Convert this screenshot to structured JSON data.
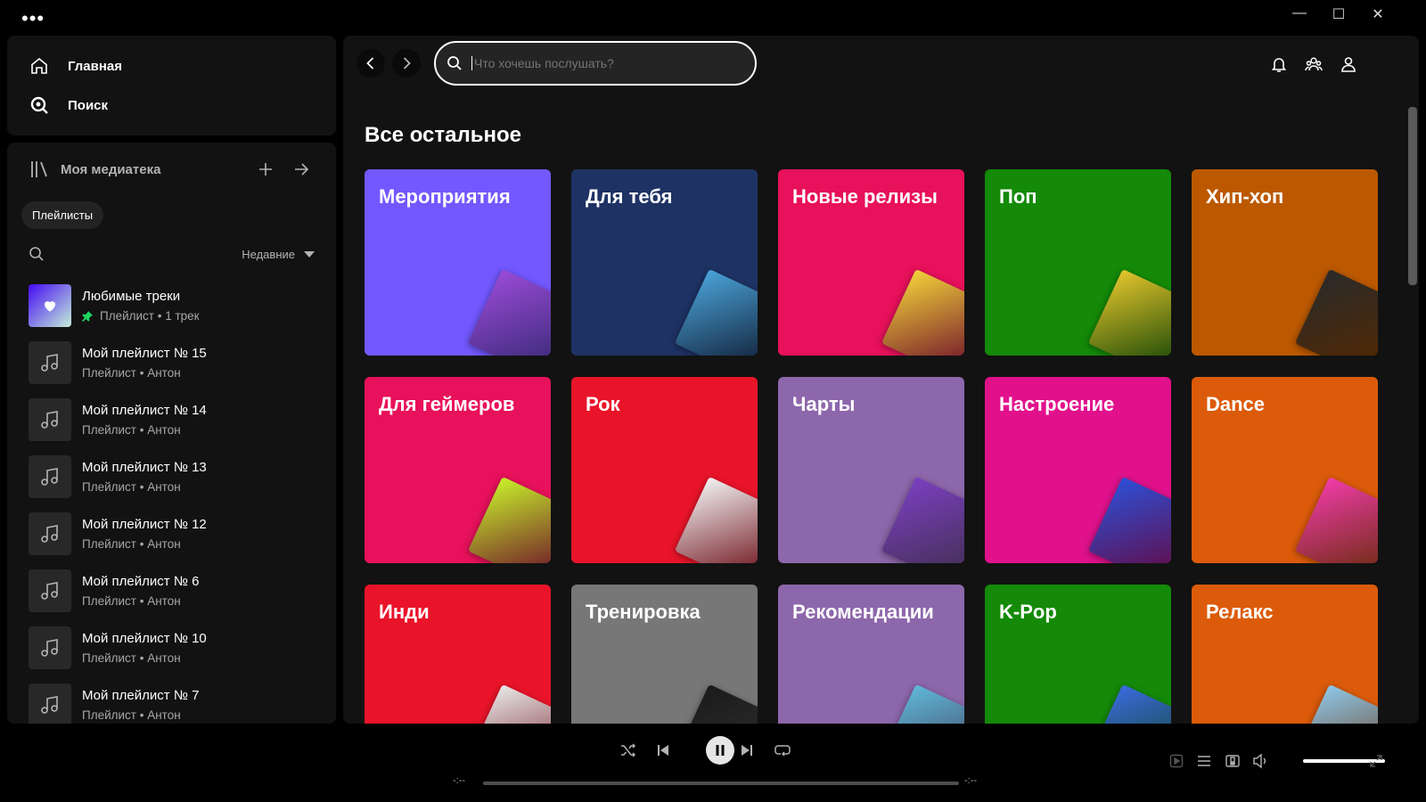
{
  "window": {
    "menu_dots": "•••",
    "minimize": "—",
    "maximize": "☐",
    "close": "✕"
  },
  "nav": {
    "home_label": "Главная",
    "search_label": "Поиск"
  },
  "library": {
    "title": "Моя медиатека",
    "chip_playlists": "Плейлисты",
    "sort_label": "Недавние",
    "items": [
      {
        "name": "Любимые треки",
        "sub": "Плейлист • 1 трек",
        "liked": true
      },
      {
        "name": "Мой плейлист № 15",
        "sub": "Плейлист • Антон"
      },
      {
        "name": "Мой плейлист № 14",
        "sub": "Плейлист • Антон"
      },
      {
        "name": "Мой плейлист № 13",
        "sub": "Плейлист • Антон"
      },
      {
        "name": "Мой плейлист № 12",
        "sub": "Плейлист • Антон"
      },
      {
        "name": "Мой плейлист № 6",
        "sub": "Плейлист • Антон"
      },
      {
        "name": "Мой плейлист № 10",
        "sub": "Плейлист • Антон"
      },
      {
        "name": "Мой плейлист № 7",
        "sub": "Плейлист • Антон"
      }
    ]
  },
  "search": {
    "placeholder": "Что хочешь послушать?"
  },
  "main": {
    "section_title": "Все остальное",
    "categories": [
      {
        "label": "Мероприятия",
        "color": "#7358ff",
        "art": "#9a4bd6"
      },
      {
        "label": "Для тебя",
        "color": "#1e3264",
        "art": "#4aa3d8"
      },
      {
        "label": "Новые релизы",
        "color": "#e8115b",
        "art": "#f3d23a"
      },
      {
        "label": "Поп",
        "color": "#148a08",
        "art": "#e3c52c"
      },
      {
        "label": "Хип-хоп",
        "color": "#bc5900",
        "art": "#2a2a2a"
      },
      {
        "label": "Для геймеров",
        "color": "#e8115b",
        "art": "#c8f02a"
      },
      {
        "label": "Рок",
        "color": "#e91429",
        "art": "#f2f2f2"
      },
      {
        "label": "Чарты",
        "color": "#8d67ab",
        "art": "#7b3fc0"
      },
      {
        "label": "Настроение",
        "color": "#e1118c",
        "art": "#2d4fd6"
      },
      {
        "label": "Dance",
        "color": "#dc5b0a",
        "art": "#f03ca8"
      },
      {
        "label": "Инди",
        "color": "#e91429",
        "art": "#e8e8e8"
      },
      {
        "label": "Тренировка",
        "color": "#777777",
        "art": "#1a1a1a"
      },
      {
        "label": "Рекомендации",
        "color": "#8d67ab",
        "art": "#5fb8d8"
      },
      {
        "label": "K-Pop",
        "color": "#148a08",
        "art": "#3a6be0"
      },
      {
        "label": "Релакс",
        "color": "#dc5b0a",
        "art": "#8fc8e8"
      }
    ]
  },
  "player": {
    "time_elapsed": "-:--",
    "time_total": "-:--"
  }
}
